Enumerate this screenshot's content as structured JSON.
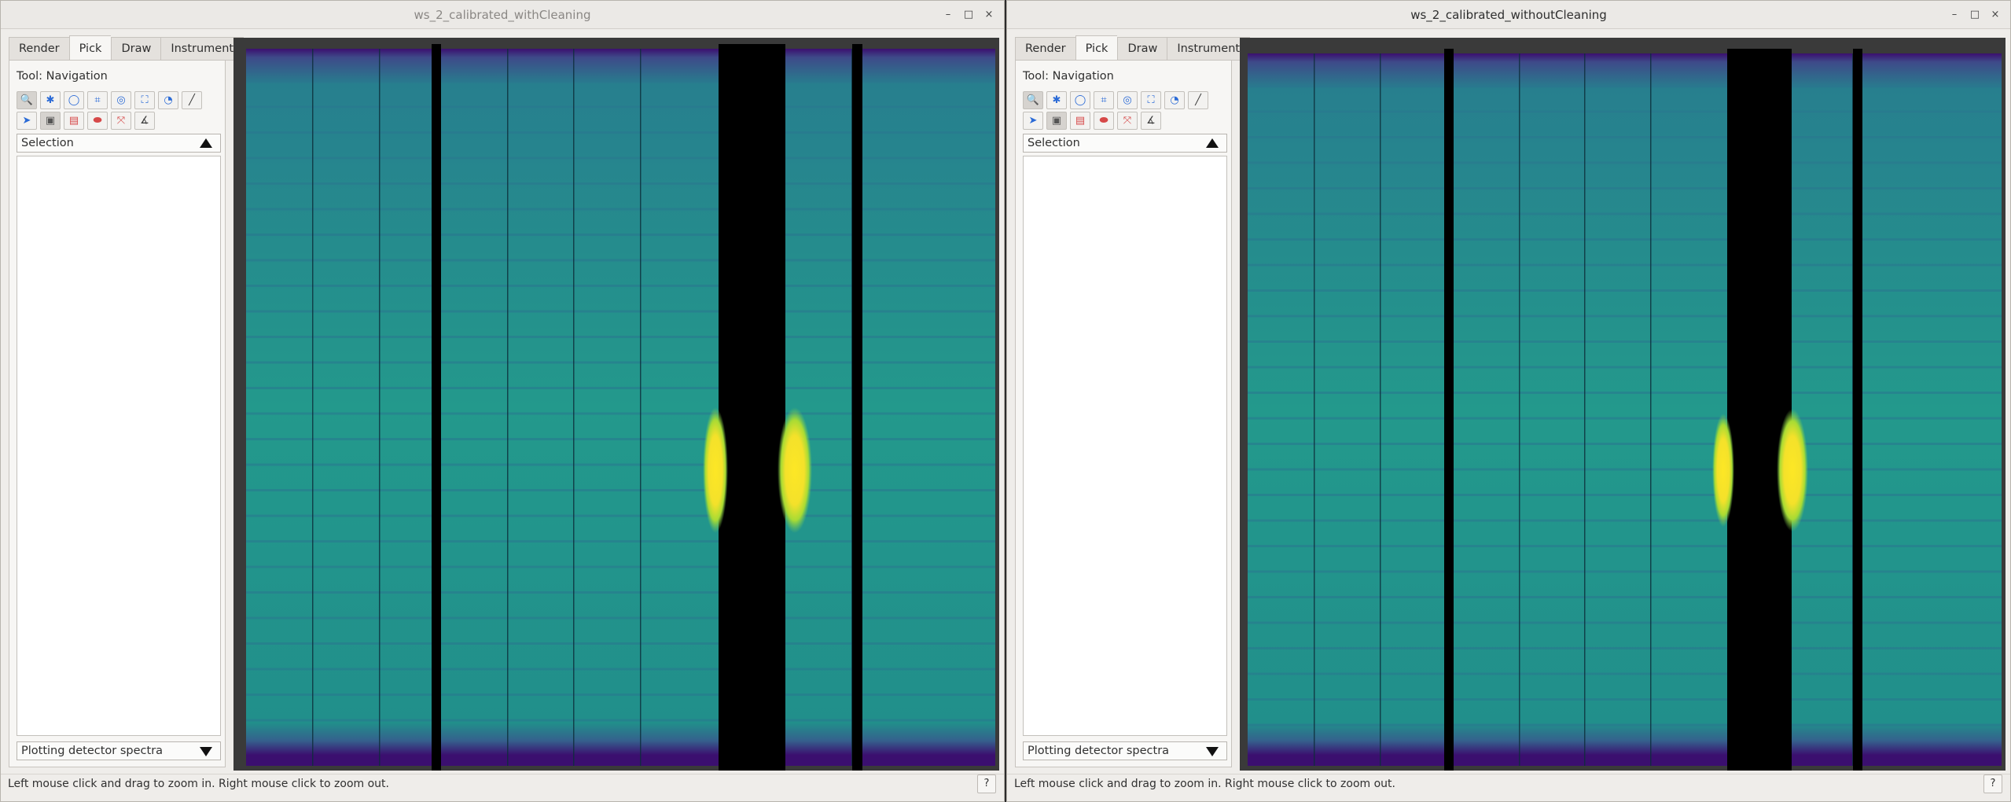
{
  "windows": [
    {
      "title": "ws_2_calibrated_withCleaning",
      "tabs": [
        "Render",
        "Pick",
        "Draw",
        "Instrument"
      ],
      "active_tab": "Pick",
      "tool_label": "Tool: Navigation",
      "selection_label": "Selection",
      "plotting_label": "Plotting detector spectra",
      "status_text": "Left mouse click and drag to zoom in. Right mouse click to zoom out.",
      "help_label": "?"
    },
    {
      "title": "ws_2_calibrated_withoutCleaning",
      "tabs": [
        "Render",
        "Pick",
        "Draw",
        "Instrument"
      ],
      "active_tab": "Pick",
      "tool_label": "Tool: Navigation",
      "selection_label": "Selection",
      "plotting_label": "Plotting detector spectra",
      "status_text": "Left mouse click and drag to zoom in. Right mouse click to zoom out.",
      "help_label": "?"
    }
  ],
  "window_controls": {
    "minimize": "–",
    "maximize": "□",
    "close": "×"
  },
  "toolbar_icons": {
    "row1": [
      "zoom-icon",
      "pick-detector-icon",
      "ellipse-select-icon",
      "rect-select-icon",
      "ring-select-icon",
      "frame-select-icon",
      "sector-select-icon",
      "free-draw-icon"
    ],
    "row2": [
      "pointer-icon",
      "detector-select-icon",
      "plot-icon",
      "erase-icon",
      "edit-shape-icon",
      "angle-icon"
    ]
  },
  "colors": {
    "viridis_body": "#23998c",
    "viridis_edge": "#3b0f6f",
    "viridis_hot": "#fde725",
    "mask": "#000000",
    "background": "#3a3a3a"
  }
}
